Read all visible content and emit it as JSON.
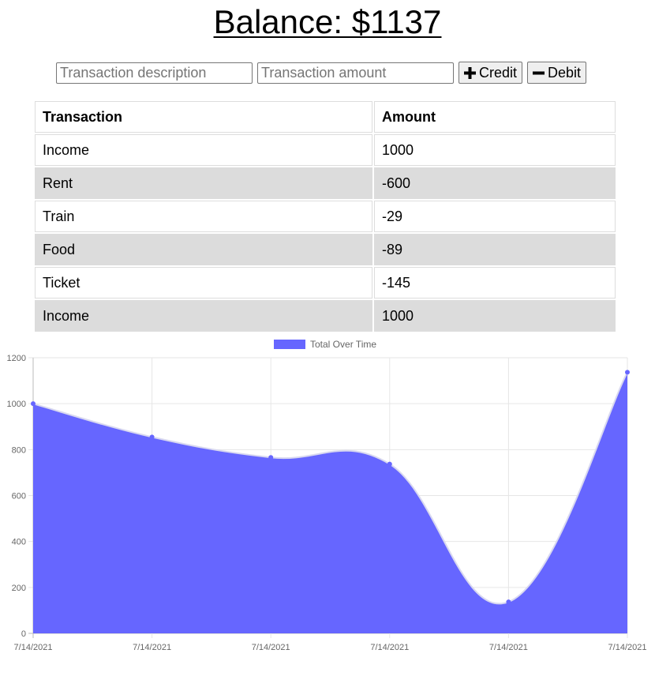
{
  "balance": {
    "label": "Balance: $",
    "amount": "1137"
  },
  "form": {
    "description_placeholder": "Transaction description",
    "amount_placeholder": "Transaction amount",
    "credit_label": "Credit",
    "debit_label": "Debit"
  },
  "table": {
    "headers": [
      "Transaction",
      "Amount"
    ],
    "rows": [
      {
        "name": "Income",
        "amount": "1000"
      },
      {
        "name": "Rent",
        "amount": "-600"
      },
      {
        "name": "Train",
        "amount": "-29"
      },
      {
        "name": "Food",
        "amount": "-89"
      },
      {
        "name": "Ticket",
        "amount": "-145"
      },
      {
        "name": "Income",
        "amount": "1000"
      }
    ]
  },
  "chart_data": {
    "type": "area",
    "legend_position": "top",
    "x": [
      "7/14/2021",
      "7/14/2021",
      "7/14/2021",
      "7/14/2021",
      "7/14/2021",
      "7/14/2021"
    ],
    "series": [
      {
        "name": "Total Over Time",
        "values": [
          1000,
          855,
          766,
          737,
          137,
          1137
        ],
        "color": "#6666ff"
      }
    ],
    "ylim": [
      0,
      1200
    ],
    "yticks": [
      0,
      200,
      400,
      600,
      800,
      1000,
      1200
    ],
    "grid": true
  }
}
